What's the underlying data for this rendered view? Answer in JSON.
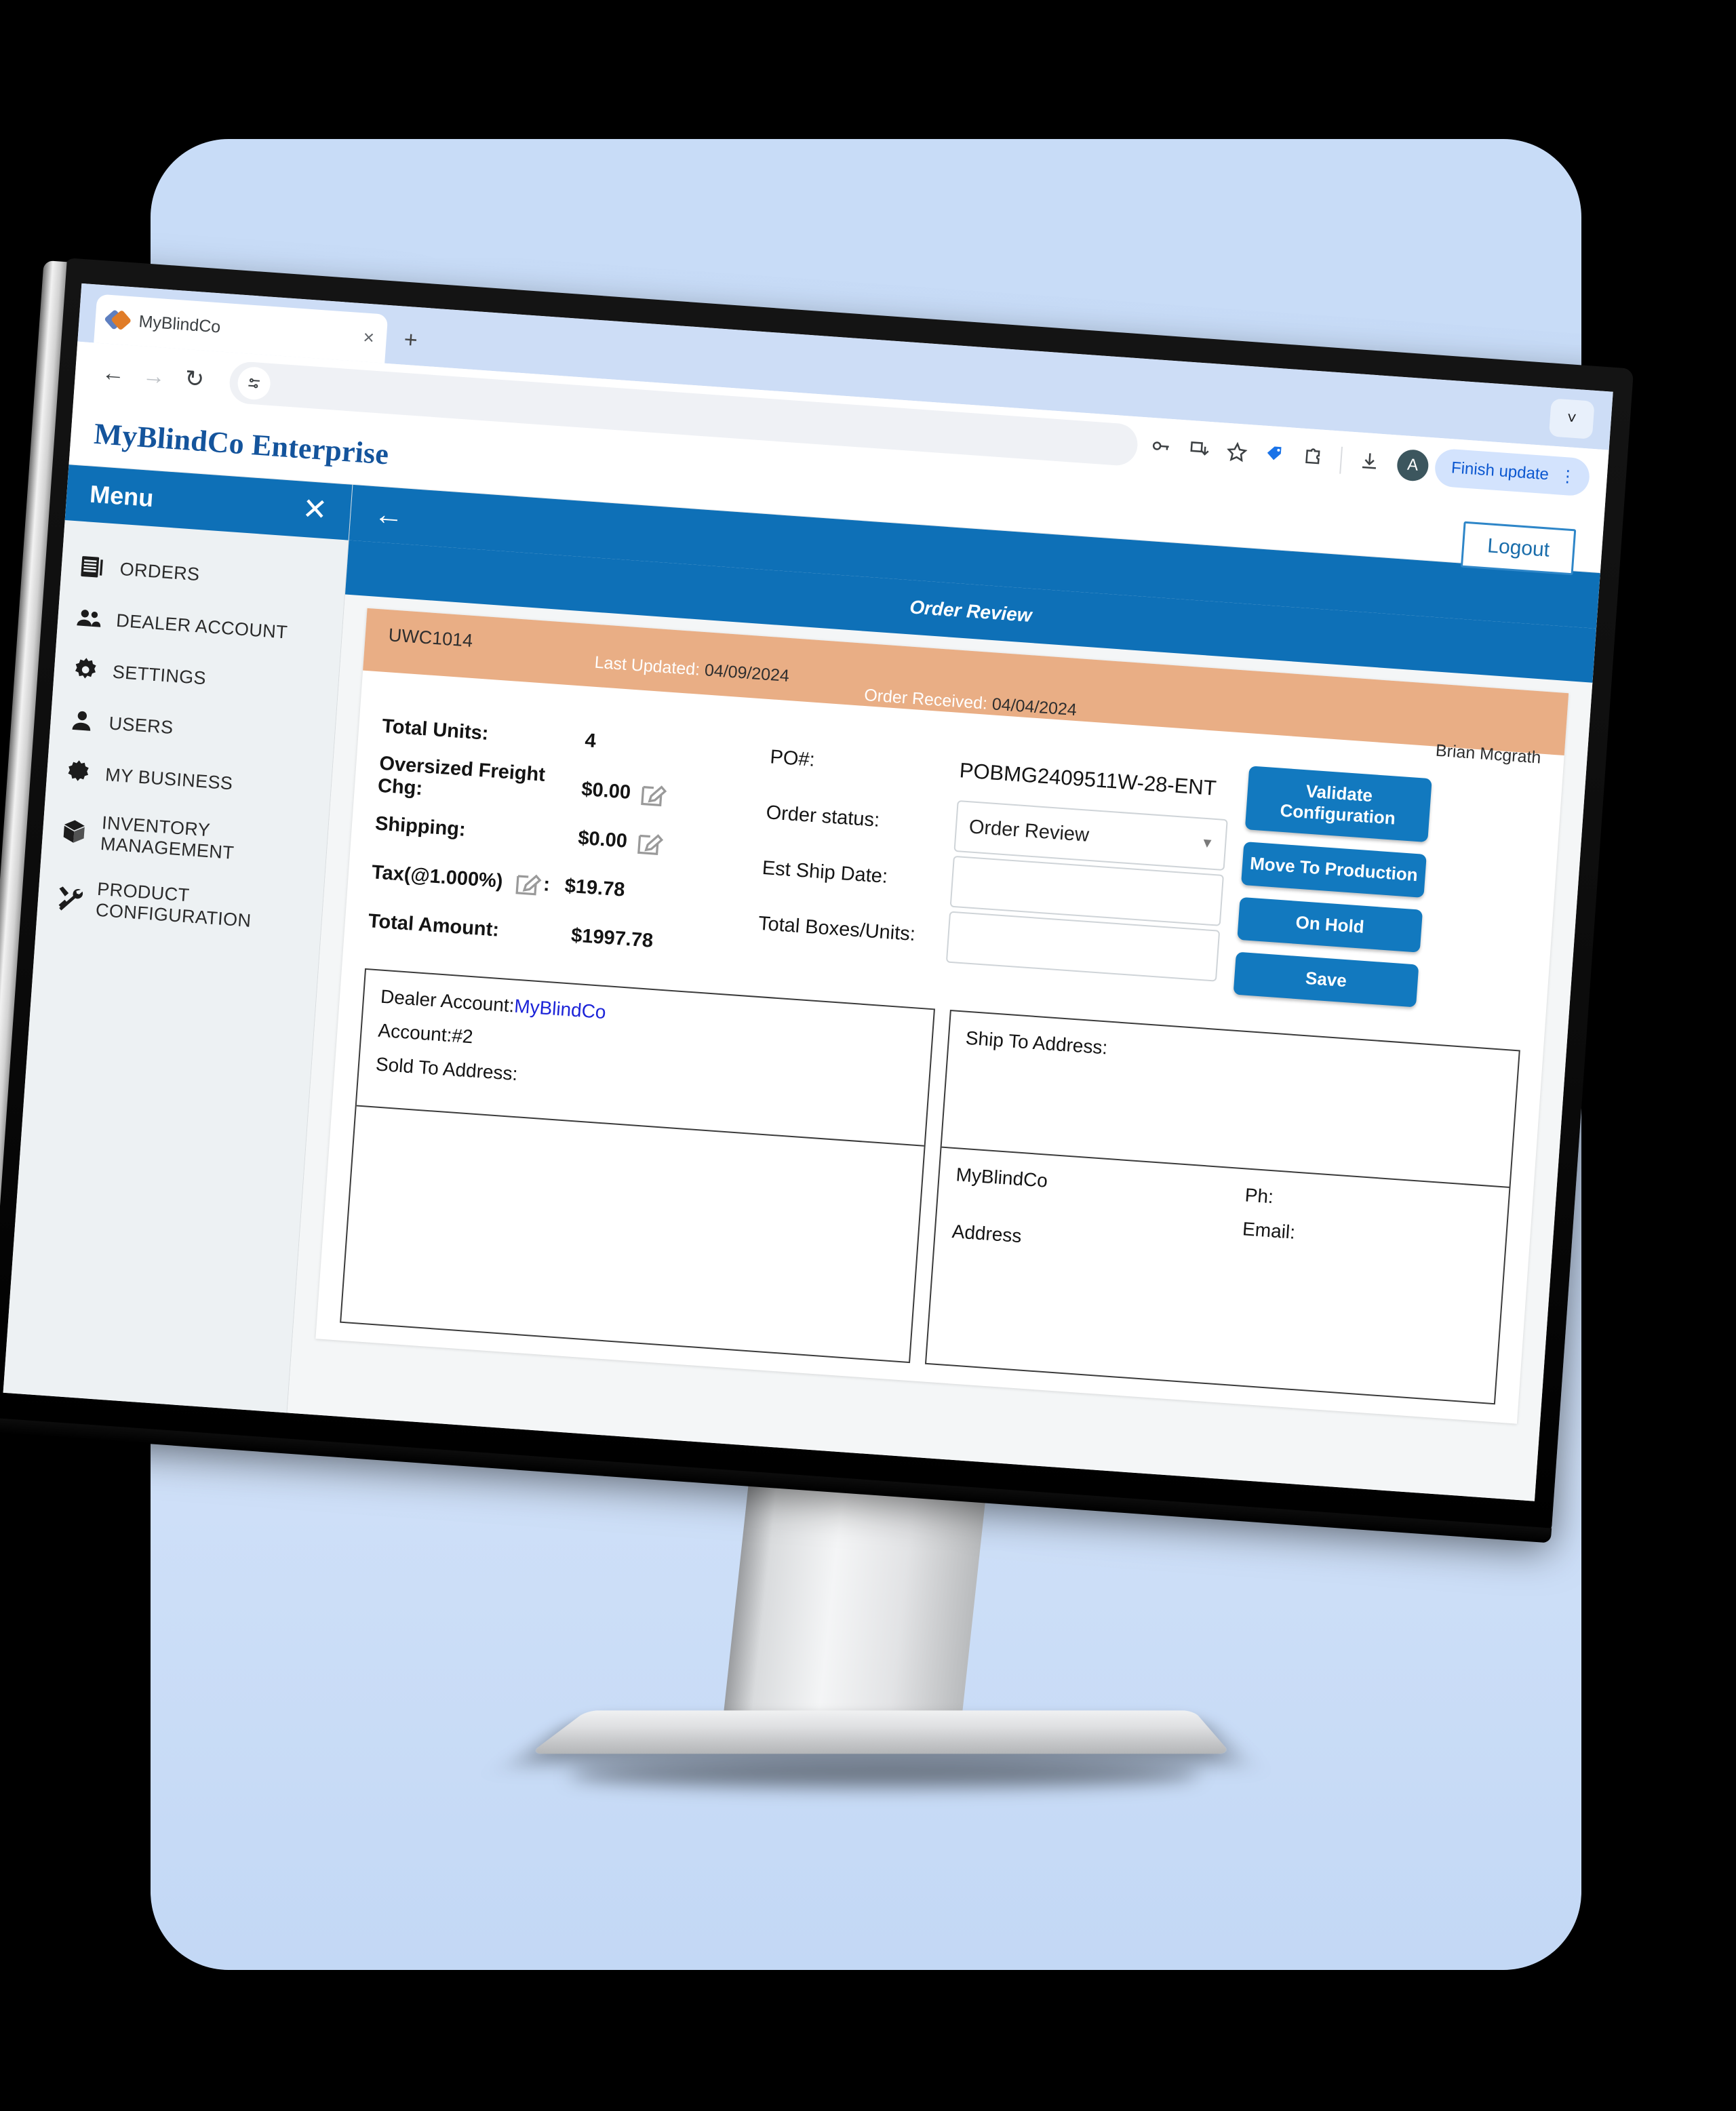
{
  "browser": {
    "tab": {
      "title": "MyBlindCo",
      "favicon": "myblindco-favicon",
      "close": "×"
    },
    "new_tab": "+",
    "tab_list_chevron": "˅",
    "nav": {
      "back": "←",
      "forward": "→",
      "reload": "↻",
      "tune": "≔"
    },
    "omni_icons": [
      "key-icon",
      "install-icon",
      "star-icon",
      "tag-icon",
      "puzzle-icon",
      "download-icon"
    ],
    "profile_initial": "A",
    "finish_update": "Finish update",
    "kebab": "⋮"
  },
  "app": {
    "brand": "MyBlindCo Enterprise",
    "logout": "Logout",
    "back_arrow": "←",
    "page_title": "Order Review"
  },
  "sidebar": {
    "title": "Menu",
    "close": "✕",
    "items": [
      {
        "label": "ORDERS",
        "icon": "orders-icon"
      },
      {
        "label": "DEALER ACCOUNT",
        "icon": "people-icon"
      },
      {
        "label": "SETTINGS",
        "icon": "gear-icon"
      },
      {
        "label": "USERS",
        "icon": "person-icon"
      },
      {
        "label": "MY BUSINESS",
        "icon": "cog-outline-icon"
      },
      {
        "label": "INVENTORY MANAGEMENT",
        "icon": "box-icon"
      },
      {
        "label": "PRODUCT CONFIGURATION",
        "icon": "tools-icon"
      }
    ]
  },
  "order_banner": {
    "order_id": "UWC1014",
    "last_updated_label": "Last Updated:",
    "last_updated_value": "04/09/2024",
    "order_received_label": "Order Received:",
    "order_received_value": "04/04/2024",
    "user": "Brian Mcgrath",
    "bg_color": "#e9ae85"
  },
  "summary": {
    "total_units_label": "Total Units:",
    "total_units_value": "4",
    "freight_label": "Oversized Freight Chg:",
    "freight_value": "$0.00",
    "shipping_label": "Shipping:",
    "shipping_value": "$0.00",
    "tax_label": "Tax(@1.000%)",
    "tax_suffix": ":",
    "tax_value": "$19.78",
    "total_label": "Total Amount:",
    "total_value": "$1997.78"
  },
  "order_fields": {
    "po_label": "PO#:",
    "po_value": "POBMG2409511W-28-ENT",
    "status_label": "Order status:",
    "status_value": "Order Review",
    "status_caret": "▼",
    "ship_date_label": "Est Ship Date:",
    "ship_date_value": "",
    "boxes_label": "Total Boxes/Units:",
    "boxes_value": ""
  },
  "actions": [
    {
      "label": "Validate Configuration",
      "name": "validate-configuration-button"
    },
    {
      "label": "Move To Production",
      "name": "move-to-production-button"
    },
    {
      "label": "On Hold",
      "name": "on-hold-button"
    },
    {
      "label": "Save",
      "name": "save-button"
    }
  ],
  "sold_to": {
    "dealer_label": "Dealer Account:",
    "dealer_value": "MyBlindCo",
    "account_label": "Account:#2",
    "sold_to_label": "Sold To Address:"
  },
  "ship_to": {
    "title": "Ship To Address:",
    "company": "MyBlindCo",
    "address": "Address",
    "phone_label": "Ph:",
    "email_label": "Email:"
  },
  "colors": {
    "accent_blue": "#0e70b7",
    "button_blue": "#1279bf",
    "banner_orange": "#e9ae85",
    "brand_blue": "#14549c",
    "link_blue": "#1c24d8",
    "backdrop_blue": "#c8dcf7"
  }
}
